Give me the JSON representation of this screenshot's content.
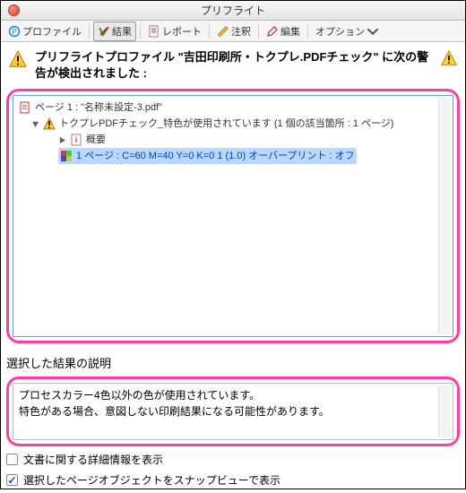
{
  "window": {
    "title": "プリフライト"
  },
  "toolbar": {
    "profile": "プロファイル",
    "results": "結果",
    "report": "レポート",
    "annotate": "注釈",
    "edit": "編集",
    "options": "オプション"
  },
  "warning": {
    "text": "プリフライトプロファイル \"吉田印刷所・トクプレ.PDFチェック\" に次の警告が検出されました :"
  },
  "tree": {
    "page_header": "ページ 1 : \"名称未設定-3.pdf\"",
    "rule": "トクプレPDFチェック_特色が使用されています (1 個の該当箇所 : 1 ページ)",
    "summary": "概要",
    "hit": "1 ページ : C=60 M=40 Y=0 K=0 1 (1.0) オーバープリント : オフ"
  },
  "description": {
    "label": "選択した結果の説明",
    "line1": "プロセスカラー4色以外の色が使用されています。",
    "line2": "特色がある場合、意図しない印刷結果になる可能性があります。"
  },
  "checks": {
    "doc_details": "文書に関する詳細情報を表示",
    "snap_view": "選択したページオブジェクトをスナップビューで表示"
  }
}
